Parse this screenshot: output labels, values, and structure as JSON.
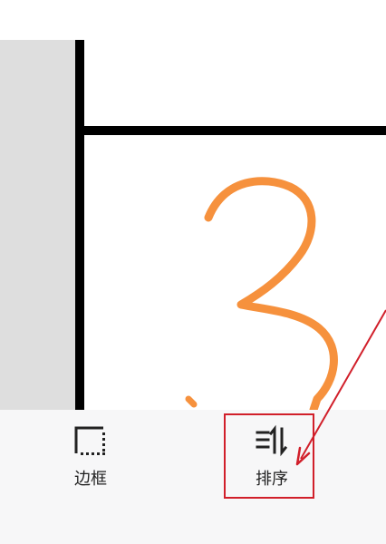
{
  "toolbar": {
    "items": [
      {
        "label": "边框",
        "icon": "border-icon"
      },
      {
        "label": "排序",
        "icon": "sort-icon"
      }
    ]
  },
  "colors": {
    "drawing_stroke": "#f6913d",
    "grid_line": "#000000",
    "gray_column": "#dedede",
    "highlight": "#d11f2a",
    "toolbar_bg": "#f7f7f8"
  }
}
